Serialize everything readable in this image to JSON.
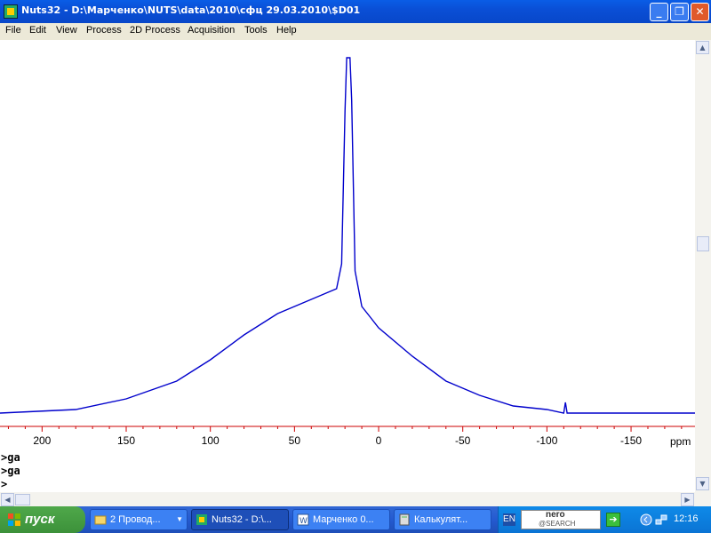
{
  "window": {
    "title": "Nuts32 - D:\\Марченко\\NUTS\\data\\2010\\сфц 29.03.2010\\$D01",
    "minimize_icon": "minimize-icon",
    "maximize_icon": "restore-icon",
    "close_icon": "close-icon"
  },
  "menu": {
    "items": [
      "File",
      "Edit",
      "View",
      "Process",
      "2D Process",
      "Acquisition",
      "Tools",
      "Help"
    ]
  },
  "chart_data": {
    "type": "line",
    "xlabel": "ppm",
    "x_reversed": true,
    "xlim": [
      225,
      -188
    ],
    "ticks": [
      "200",
      "150",
      "100",
      "50",
      "0",
      "-50",
      "-100",
      "-150"
    ],
    "tick_values": [
      200,
      150,
      100,
      50,
      0,
      -50,
      -100,
      -150
    ],
    "series_color": "#0000cc",
    "axis_color": "#cc0000",
    "peak_ppm": 18,
    "spectrum": {
      "x": [
        225,
        180,
        150,
        120,
        100,
        80,
        60,
        40,
        30,
        25,
        22,
        20,
        19,
        18,
        17,
        16,
        14,
        10,
        5,
        0,
        -20,
        -40,
        -60,
        -80,
        -100,
        -110,
        -111,
        -112,
        -130,
        -160,
        -188
      ],
      "y": [
        0.0,
        0.01,
        0.04,
        0.09,
        0.15,
        0.22,
        0.28,
        0.32,
        0.34,
        0.35,
        0.42,
        0.85,
        1.0,
        1.0,
        1.0,
        0.88,
        0.4,
        0.3,
        0.27,
        0.24,
        0.16,
        0.09,
        0.05,
        0.02,
        0.01,
        0.0,
        0.03,
        0.0,
        0.0,
        0.0,
        0.0
      ]
    }
  },
  "command": {
    "lines": [
      ">ga",
      ">ga",
      ">"
    ]
  },
  "taskbar": {
    "start_label": "пуск",
    "tasks": [
      {
        "label": "2 Провод...",
        "icon": "folder-icon"
      },
      {
        "label": "Nuts32 - D:\\...",
        "icon": "nuts-app-icon"
      },
      {
        "label": "Марченко 0...",
        "icon": "word-document-icon"
      },
      {
        "label": "Калькулят...",
        "icon": "calculator-icon"
      }
    ],
    "language": "EN",
    "nero_top": "nero",
    "nero_bottom": "@SEARCH",
    "clock": "12:16"
  }
}
